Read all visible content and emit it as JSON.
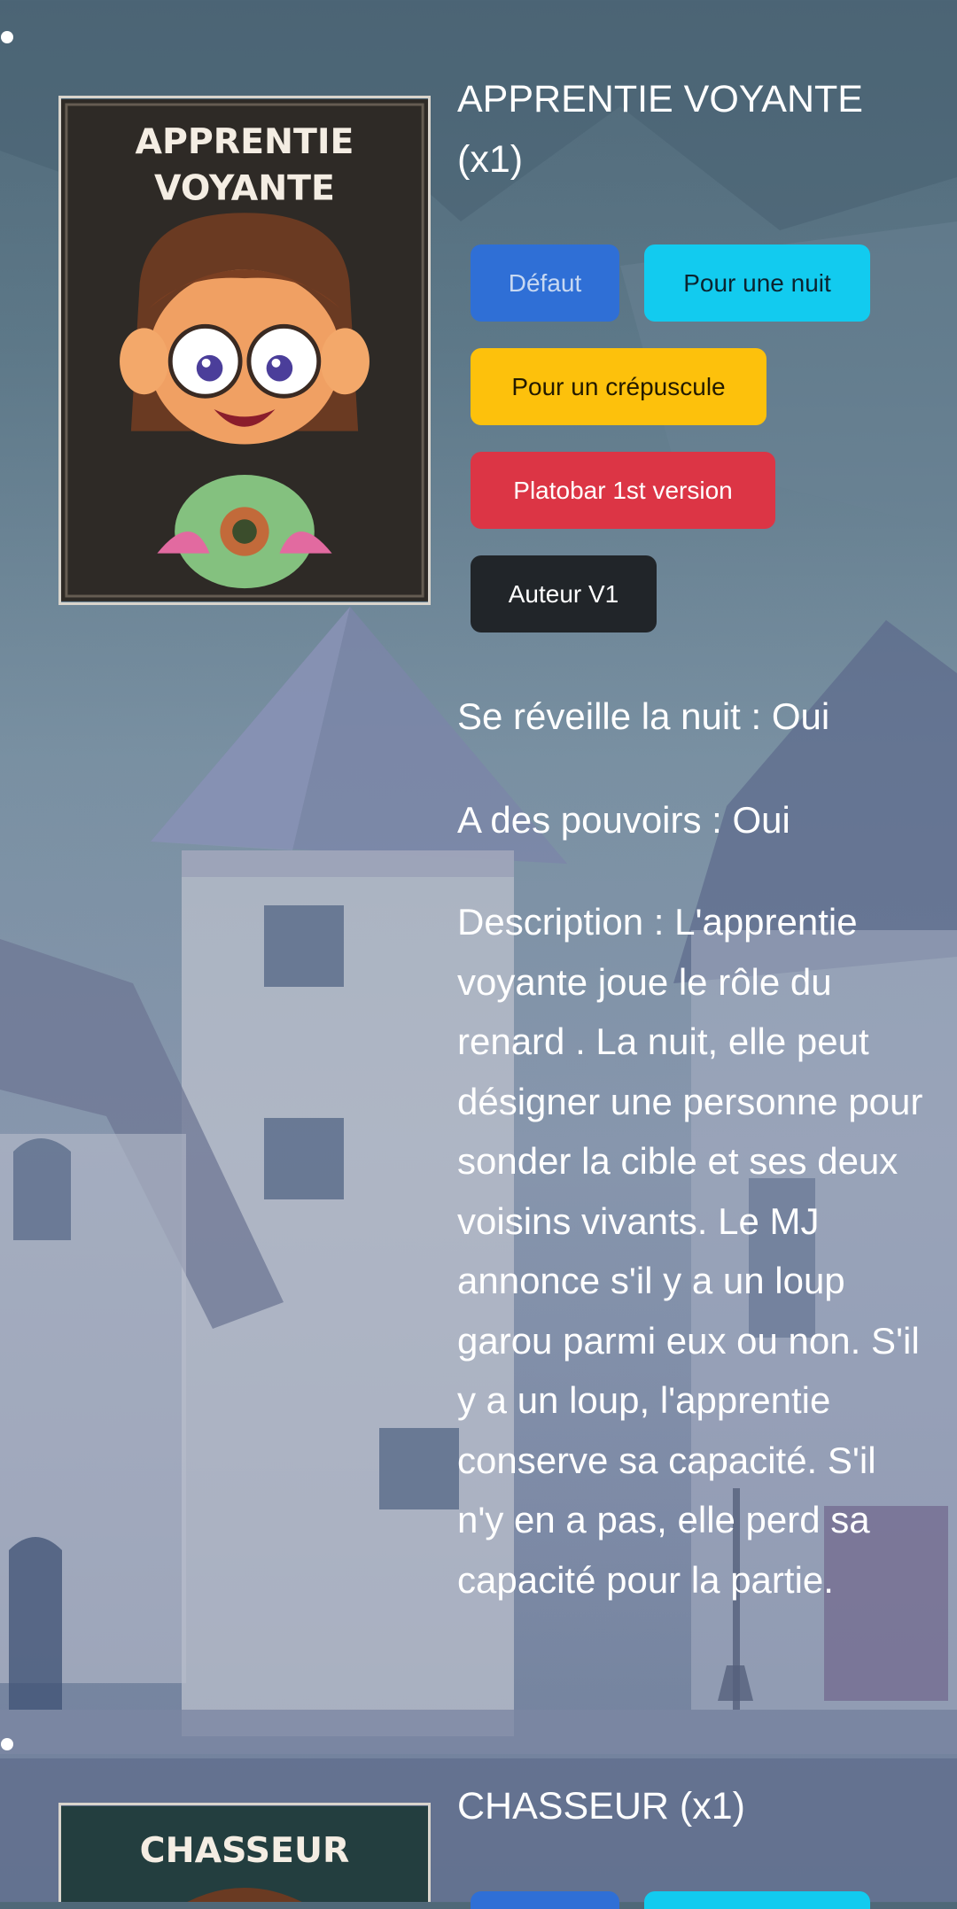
{
  "roles": [
    {
      "title": "APPRENTIE VOYANTE (x1)",
      "card_text_line1": "APPRENTIE",
      "card_text_line2": "VOYANTE",
      "buttons": {
        "default": "Défaut",
        "one_night": "Pour une nuit",
        "twilight": "Pour un crépuscule",
        "platobar": "Platobar 1st version",
        "author": "Auteur V1"
      },
      "wakes_at_night": "Se réveille la nuit : Oui",
      "has_powers": "A des pouvoirs : Oui",
      "description": "Description : L'apprentie voyante joue le rôle du renard . La nuit, elle peut désigner une personne pour sonder la cible et ses deux voisins vivants. Le MJ annonce s'il y a un loup garou parmi eux ou non. S'il y a un loup, l'apprentie conserve sa capacité. S'il n'y en a pas, elle perd sa capacité pour la partie."
    },
    {
      "title": "CHASSEUR (x1)",
      "card_text_line1": "CHASSEUR"
    }
  ],
  "colors": {
    "default_btn": "#2f6fd6",
    "one_night_btn": "#12cbef",
    "twilight_btn": "#fdc10c",
    "platobar_btn": "#dc3545",
    "author_btn": "#212529"
  },
  "icons": [
    "bullet-dot",
    "card-illustration"
  ]
}
